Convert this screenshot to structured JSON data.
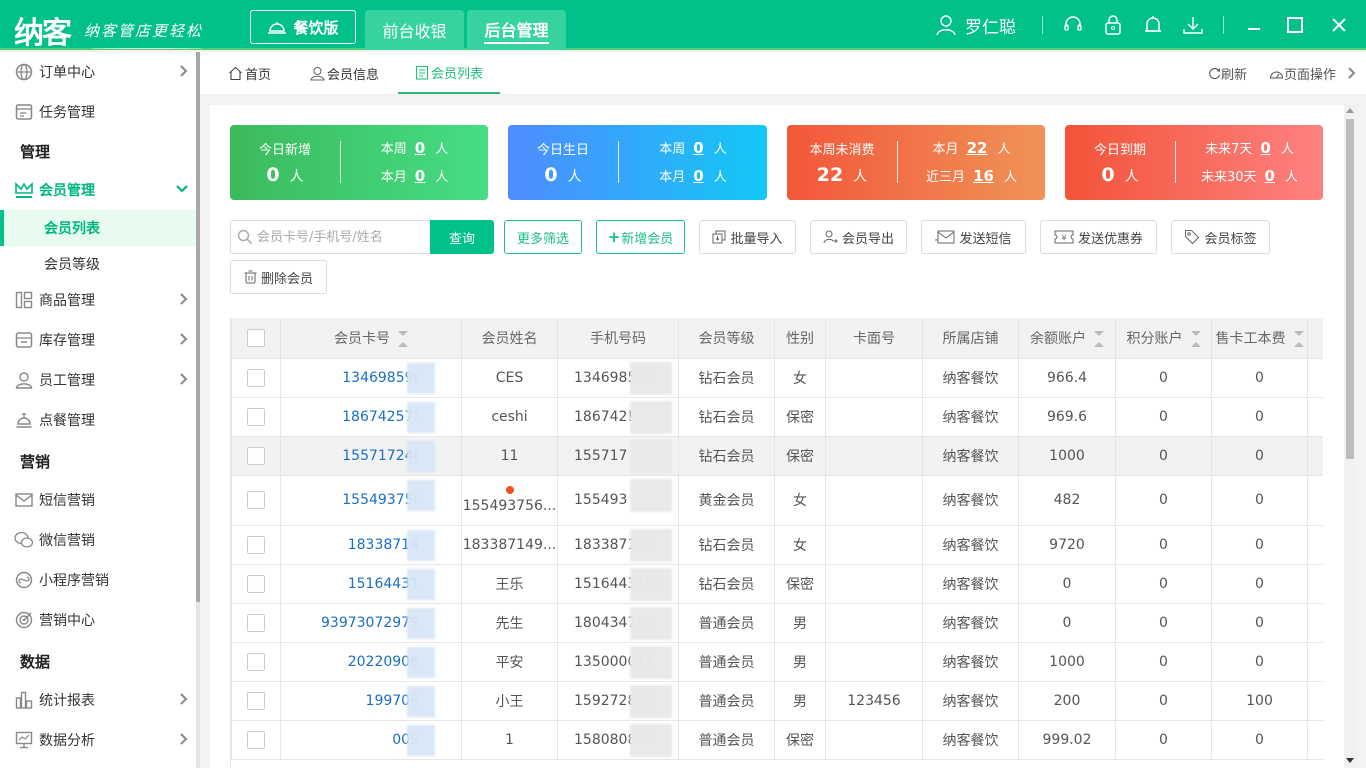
{
  "app": {
    "logo": "纳客",
    "slogan": "纳客管店更轻松",
    "edition_label": "餐饮版",
    "top_tabs": [
      {
        "label": "前台收银",
        "active": false
      },
      {
        "label": "后台管理",
        "active": true
      }
    ],
    "user_name": "罗仁聪",
    "icons": [
      "headset-icon",
      "lock-icon",
      "bell-icon",
      "download-icon"
    ],
    "window_controls": [
      "minimize",
      "maximize",
      "close"
    ]
  },
  "sidebar": {
    "items": [
      {
        "label": "订单中心",
        "icon": "globe-icon",
        "chevron": true
      },
      {
        "label": "任务管理",
        "icon": "task-icon",
        "chevron": false
      }
    ],
    "section_manage": "管理",
    "member_mgmt": "会员管理",
    "member_sub": [
      {
        "label": "会员列表",
        "active": true
      },
      {
        "label": "会员等级",
        "active": false
      }
    ],
    "manage_items": [
      {
        "label": "商品管理",
        "icon": "goods-icon",
        "chevron": true
      },
      {
        "label": "库存管理",
        "icon": "inventory-icon",
        "chevron": true
      },
      {
        "label": "员工管理",
        "icon": "staff-icon",
        "chevron": true
      },
      {
        "label": "点餐管理",
        "icon": "dining-bell-icon",
        "chevron": false
      }
    ],
    "section_marketing": "营销",
    "marketing_items": [
      {
        "label": "短信营销",
        "icon": "mail-icon"
      },
      {
        "label": "微信营销",
        "icon": "wechat-icon"
      },
      {
        "label": "小程序营销",
        "icon": "miniprogram-icon"
      },
      {
        "label": "营销中心",
        "icon": "target-icon"
      }
    ],
    "section_data": "数据",
    "data_items": [
      {
        "label": "统计报表",
        "icon": "bar-chart-icon",
        "chevron": true
      },
      {
        "label": "数据分析",
        "icon": "monitor-chart-icon",
        "chevron": true
      }
    ]
  },
  "page_tabs": [
    {
      "label": "首页",
      "icon": "home-icon",
      "active": false
    },
    {
      "label": "会员信息",
      "icon": "user-icon",
      "active": false
    },
    {
      "label": "会员列表",
      "icon": "clipboard-icon",
      "active": true
    }
  ],
  "tab_actions": {
    "refresh": "刷新",
    "page_ops": "页面操作"
  },
  "stats": [
    {
      "title": "今日新增",
      "value": "0",
      "unit": "人",
      "r1_label": "本周",
      "r1_value": "0",
      "r2_label": "本月",
      "r2_value": "0"
    },
    {
      "title": "今日生日",
      "value": "0",
      "unit": "人",
      "r1_label": "本周",
      "r1_value": "0",
      "r2_label": "本月",
      "r2_value": "0"
    },
    {
      "title": "本周未消费",
      "value": "22",
      "unit": "人",
      "r1_label": "本月",
      "r1_value": "22",
      "r2_label": "近三月",
      "r2_value": "16"
    },
    {
      "title": "今日到期",
      "value": "0",
      "unit": "人",
      "r1_label": "未来7天",
      "r1_value": "0",
      "r2_label": "未来30天",
      "r2_value": "0"
    }
  ],
  "toolbar": {
    "search_placeholder": "会员卡号/手机号/姓名",
    "search_value": "",
    "query": "查询",
    "more_filter": "更多筛选",
    "add_member": "新增会员",
    "batch_import": "批量导入",
    "export": "会员导出",
    "send_sms": "发送短信",
    "send_coupon": "发送优惠券",
    "tags": "会员标签",
    "delete": "删除会员"
  },
  "table": {
    "columns": [
      "会员卡号",
      "会员姓名",
      "手机号码",
      "会员等级",
      "性别",
      "卡面号",
      "所属店铺",
      "余额账户",
      "积分账户",
      "售卡工本费"
    ],
    "rows": [
      {
        "card": "13469859(",
        "name": "CES",
        "phone": "134698591",
        "level": "钻石会员",
        "gender": "女",
        "face": "",
        "store": "纳客餐饮",
        "balance": "966.4",
        "points": "0",
        "fee": "0"
      },
      {
        "card": "18674257!",
        "name": "ceshi",
        "phone": "186742!",
        "level": "钻石会员",
        "gender": "保密",
        "face": "",
        "store": "纳客餐饮",
        "balance": "969.6",
        "points": "0",
        "fee": "0"
      },
      {
        "card": "15571724(",
        "name": "11",
        "phone": "155717",
        "level": "钻石会员",
        "gender": "保密",
        "face": "",
        "store": "纳客餐饮",
        "balance": "1000",
        "points": "0",
        "fee": "0",
        "highlight": true
      },
      {
        "card": "15549375(",
        "name": "155493756...",
        "phone": "155493",
        "level": "黄金会员",
        "gender": "女",
        "face": "",
        "store": "纳客餐饮",
        "balance": "482",
        "points": "0",
        "fee": "0",
        "dot": true
      },
      {
        "card": "18338714",
        "name": "183387149...",
        "phone": "18338714!",
        "level": "钻石会员",
        "gender": "女",
        "face": "",
        "store": "纳客餐饮",
        "balance": "9720",
        "points": "0",
        "fee": "0"
      },
      {
        "card": "15164431",
        "name": "王乐",
        "phone": "1516443150",
        "level": "钻石会员",
        "gender": "保密",
        "face": "",
        "store": "纳客餐饮",
        "balance": "0",
        "points": "0",
        "fee": "0"
      },
      {
        "card": "93973072979",
        "name": "先生",
        "phone": "180434752",
        "level": "普通会员",
        "gender": "男",
        "face": "",
        "store": "纳客餐饮",
        "balance": "0",
        "points": "0",
        "fee": "0"
      },
      {
        "card": "20220906",
        "name": "平安",
        "phone": "135000011",
        "level": "普通会员",
        "gender": "男",
        "face": "",
        "store": "纳客餐饮",
        "balance": "1000",
        "points": "0",
        "fee": "0"
      },
      {
        "card": "199709",
        "name": "小王",
        "phone": "159272855",
        "level": "普通会员",
        "gender": "男",
        "face": "123456",
        "store": "纳客餐饮",
        "balance": "200",
        "points": "0",
        "fee": "100"
      },
      {
        "card": "009",
        "name": "1",
        "phone": "15808080C",
        "level": "普通会员",
        "gender": "保密",
        "face": "",
        "store": "纳客餐饮",
        "balance": "999.02",
        "points": "0",
        "fee": "0"
      }
    ]
  },
  "colors": {
    "brand": "#00c18a",
    "link": "#1a6fc4",
    "active_bg": "#e7fbef"
  }
}
